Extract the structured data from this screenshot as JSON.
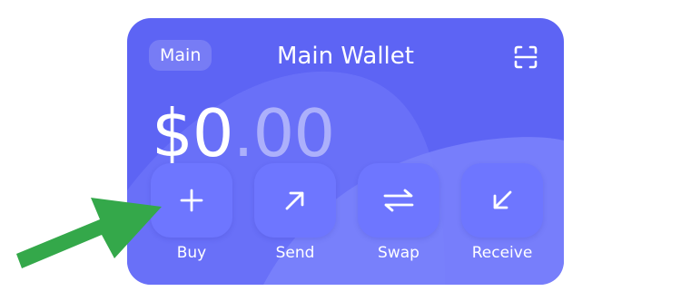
{
  "wallet": {
    "account_chip": "Main",
    "title": "Main Wallet",
    "balance_whole": "$0",
    "balance_decimal": ".00"
  },
  "actions": [
    {
      "label": "Buy",
      "icon": "plus-icon"
    },
    {
      "label": "Send",
      "icon": "arrow-up-right-icon"
    },
    {
      "label": "Swap",
      "icon": "swap-arrows-icon"
    },
    {
      "label": "Receive",
      "icon": "arrow-down-left-icon"
    }
  ],
  "colors": {
    "card": "#5d64f4",
    "button": "#6e76ff",
    "annotation_arrow": "#34a84a"
  }
}
